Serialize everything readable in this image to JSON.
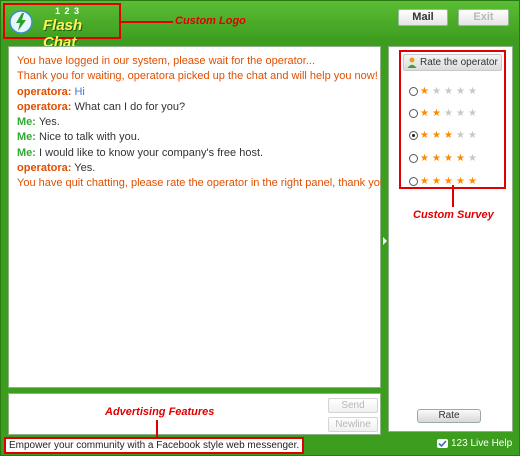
{
  "header": {
    "logo_number": "1 2 3",
    "logo_text": "Flash Chat",
    "logo_annotation": "Custom Logo",
    "mail_button": "Mail",
    "exit_button": "Exit"
  },
  "chat": {
    "messages": [
      {
        "type": "system",
        "text": "You have logged in our system, please wait for the operator..."
      },
      {
        "type": "system",
        "text": "Thank you for waiting, operatora picked up the chat and will help you now!"
      },
      {
        "type": "operator",
        "sender": "operatora:",
        "text": "Hi"
      },
      {
        "type": "operator",
        "sender": "operatora:",
        "text": "What can I do for you?"
      },
      {
        "type": "me",
        "sender": "Me:",
        "text": "Yes."
      },
      {
        "type": "me",
        "sender": "Me:",
        "text": "Nice to talk with you."
      },
      {
        "type": "me",
        "sender": "Me:",
        "text": "I would like to know your company's free  host."
      },
      {
        "type": "operator",
        "sender": "operatora:",
        "text": "Yes."
      },
      {
        "type": "system",
        "text": "You have quit chatting, please rate the operator in the right panel, thank you!"
      }
    ]
  },
  "survey": {
    "title": "Rate the operator",
    "annotation": "Custom Survey",
    "options": [
      {
        "stars": 1,
        "selected": false
      },
      {
        "stars": 2,
        "selected": false
      },
      {
        "stars": 3,
        "selected": true
      },
      {
        "stars": 4,
        "selected": false
      },
      {
        "stars": 5,
        "selected": false
      }
    ],
    "max_stars": 5,
    "rate_button": "Rate"
  },
  "input": {
    "value": "",
    "send_button": "Send",
    "newline_button": "Newline"
  },
  "footer": {
    "advertising_annotation": "Advertising Features",
    "promo_text": "Empower your community with a Facebook style web messenger.",
    "brand": "123 Live Help"
  },
  "colors": {
    "frame_green": "#3d9d1f",
    "annotation_red": "#e00000",
    "system_orange": "#e05000",
    "me_green": "#33aa33",
    "star_orange": "#ff8a00"
  },
  "icons": {
    "logo": "lightning-bolt-icon",
    "survey": "operator-person-icon",
    "brand": "checkmark-icon"
  }
}
